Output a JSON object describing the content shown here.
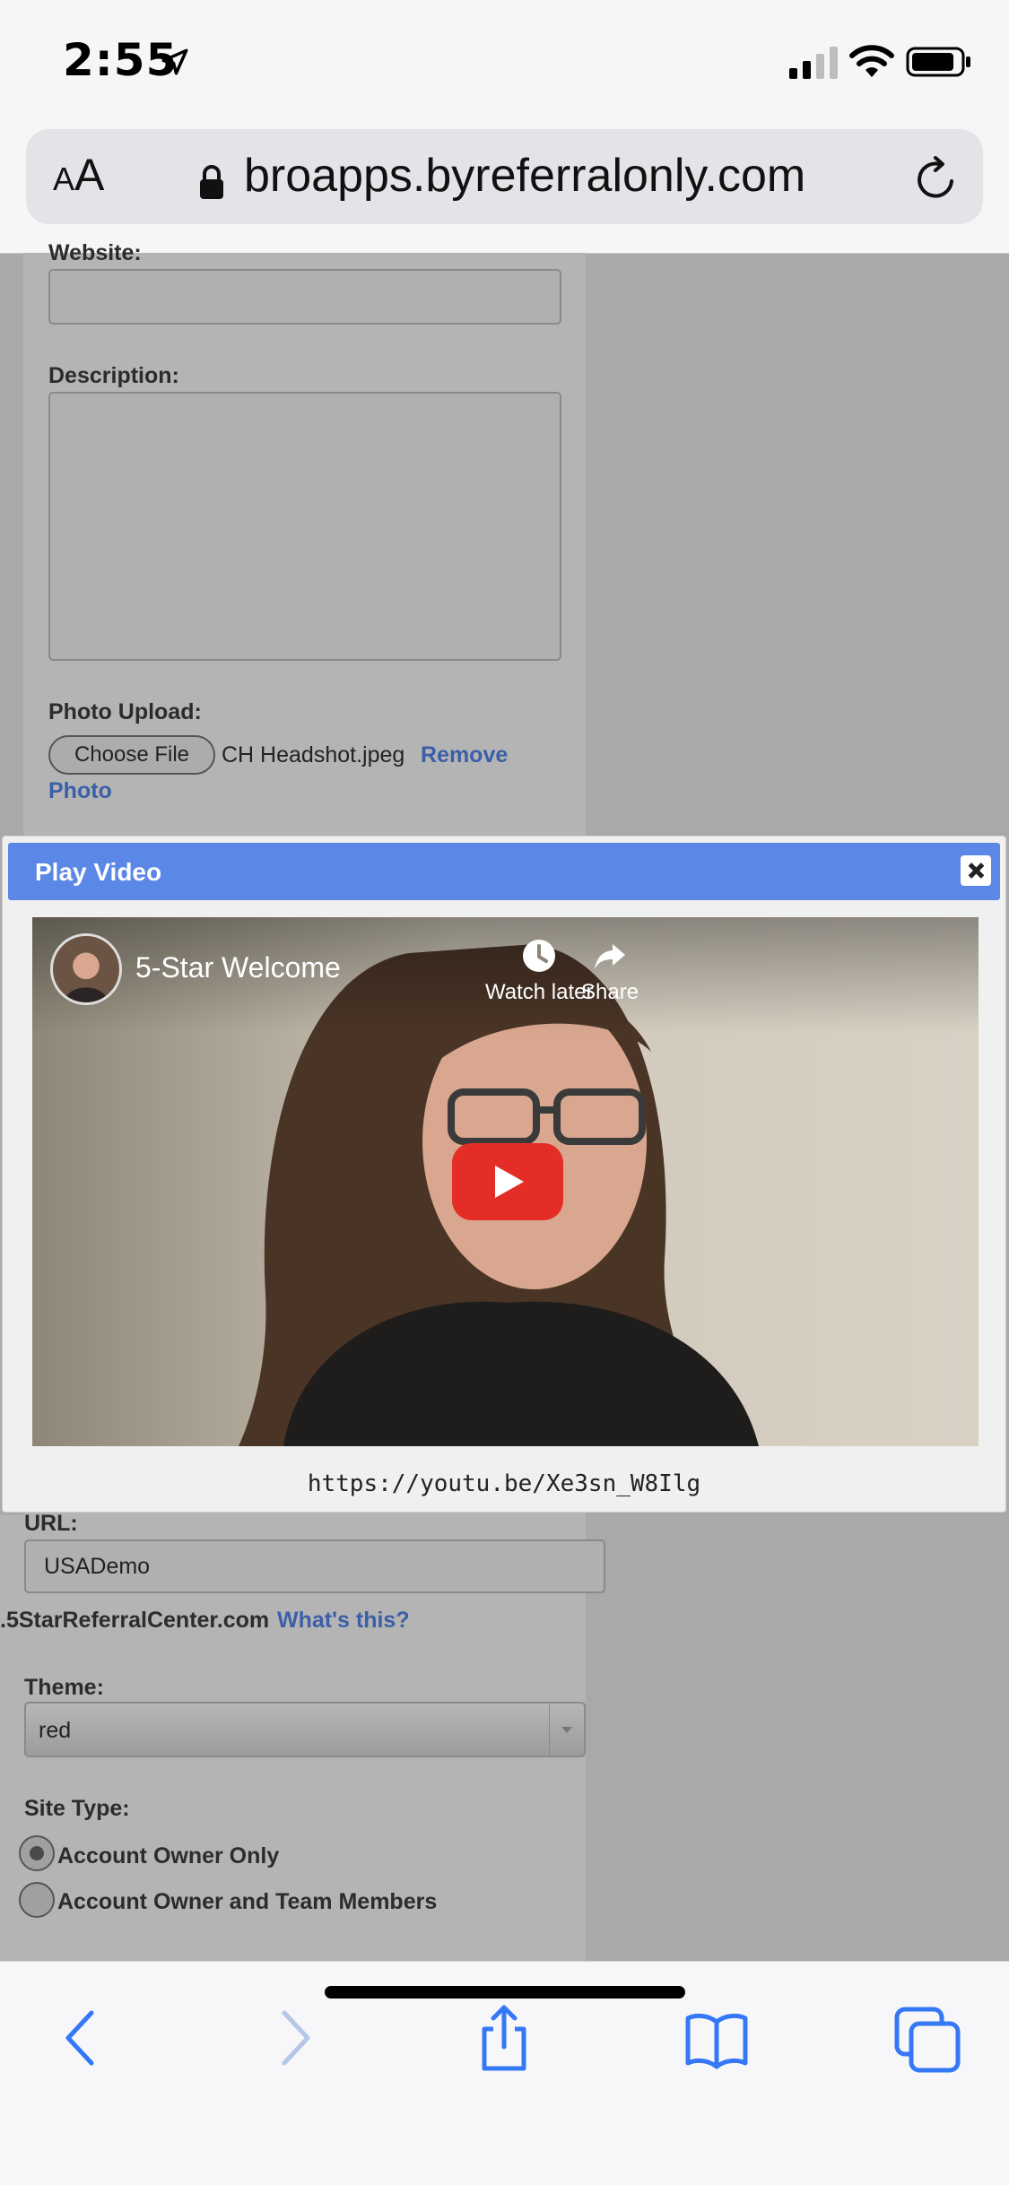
{
  "status_bar": {
    "time": "2:55"
  },
  "address_bar": {
    "text_size_label_small": "A",
    "text_size_label_large": "A",
    "domain": "broapps.byreferralonly.com"
  },
  "form": {
    "website_label": "Website:",
    "description_label": "Description:",
    "photo_upload_label": "Photo Upload:",
    "choose_file_label": "Choose File",
    "file_name": "CH Headshot.jpeg",
    "remove_photo_label_1": "Remove",
    "remove_photo_label_2": "Photo",
    "url_label": "URL:",
    "url_value": "USADemo",
    "domain_suffix": ".5StarReferralCenter.com",
    "whats_this_label": "What's this?",
    "theme_label": "Theme:",
    "theme_value": "red",
    "site_type_label": "Site Type:",
    "site_type_options": [
      {
        "label": "Account Owner Only",
        "checked": true
      },
      {
        "label": "Account Owner and Team Members",
        "checked": false
      }
    ]
  },
  "modal": {
    "title": "Play Video",
    "video": {
      "title": "5-Star Welcome",
      "watch_later_label": "Watch later",
      "share_label": "Share"
    },
    "video_url": "https://youtu.be/Xe3sn_W8Ilg"
  },
  "colors": {
    "modal_header": "#5b87e6",
    "link": "#3b5fa8",
    "toolbar_icon": "#3478f6",
    "play_button": "#e52d27"
  },
  "toolbar": {
    "icons": [
      "back-icon",
      "forward-icon",
      "share-icon",
      "bookmarks-icon",
      "tabs-icon"
    ]
  }
}
